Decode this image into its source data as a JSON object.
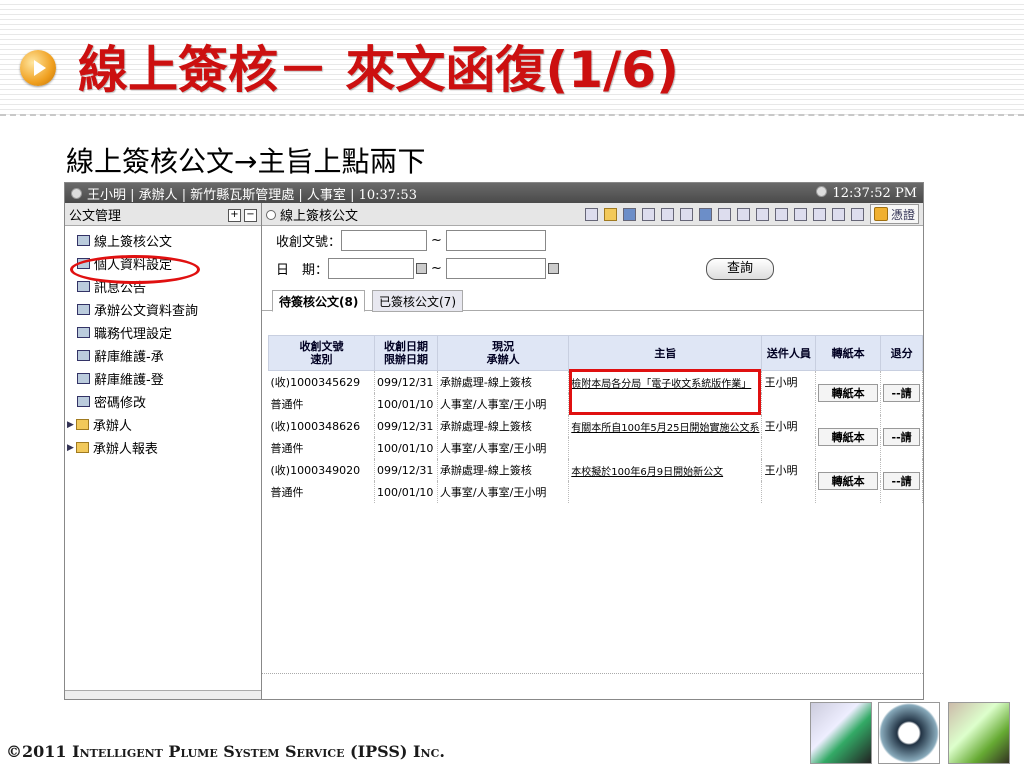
{
  "slide": {
    "title": "線上簽核－ 來文函復(1/6)",
    "subtitle": "線上簽核公文→主旨上點兩下",
    "footer": "©2011 Intelligent Plume System Service (IPSS) Inc."
  },
  "app": {
    "user_bar": "王小明 | 承辦人 | 新竹縣瓦斯管理處 | 人事室 | 10:37:53",
    "clock": "12:37:52 PM",
    "sidebar": {
      "title": "公文管理",
      "items": [
        "線上簽核公文",
        "個人資料設定",
        "訊息公告",
        "承辦公文資料查詢",
        "職務代理設定",
        "辭庫維護-承",
        "辭庫維護-登",
        "密碼修改"
      ],
      "folders": [
        "承辦人",
        "承辦人報表"
      ]
    },
    "main": {
      "title": "線上簽核公文",
      "cert_label": "憑證",
      "form": {
        "doc_no_label": "收創文號：",
        "date_label": "日　期：",
        "tilde": "~",
        "query_button": "查詢"
      },
      "tabs": {
        "pending": "待簽核公文(8)",
        "signed": "已簽核公文(7)"
      },
      "columns": [
        "收創文號\n速別",
        "收創日期\n限辦日期",
        "現況\n承辦人",
        "主旨",
        "送件人員",
        "轉紙本",
        "退分"
      ],
      "rows": [
        {
          "doc_no": "(收)1000345629",
          "priority": "普通件",
          "date": "099/12/31",
          "deadline": "100/01/10",
          "status": "承辦處理-線上簽核",
          "handler": "人事室/人事室/王小明",
          "subject": "檢附本局各分局「電子收文系統版作業」",
          "sender": "王小明",
          "paper_btn": "轉紙本",
          "return_btn": "--請"
        },
        {
          "doc_no": "(收)1000348626",
          "priority": "普通件",
          "date": "099/12/31",
          "deadline": "100/01/10",
          "status": "承辦處理-線上簽核",
          "handler": "人事室/人事室/王小明",
          "subject": "有關本所自100年5月25日開始實施公文系",
          "sender": "王小明",
          "paper_btn": "轉紙本",
          "return_btn": "--請"
        },
        {
          "doc_no": "(收)1000349020",
          "priority": "普通件",
          "date": "099/12/31",
          "deadline": "100/01/10",
          "status": "承辦處理-線上簽核",
          "handler": "人事室/人事室/王小明",
          "subject": "本校擬於100年6月9日開始新公文",
          "sender": "王小明",
          "paper_btn": "轉紙本",
          "return_btn": "--請"
        }
      ]
    }
  }
}
